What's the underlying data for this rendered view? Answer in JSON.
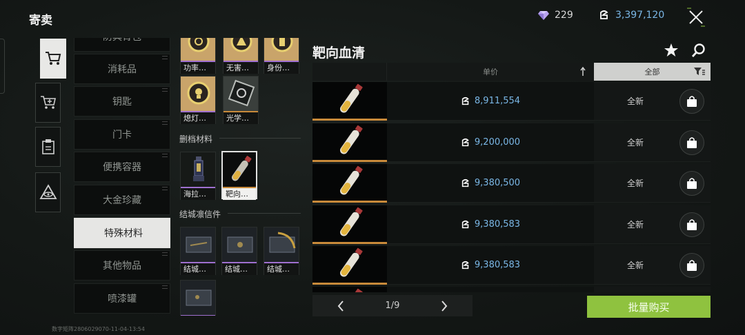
{
  "header": {
    "title": "寄卖",
    "gems": "229",
    "coins": "3,397,120"
  },
  "categories": [
    "防具背包",
    "消耗品",
    "钥匙",
    "门卡",
    "便携容器",
    "大金珍藏",
    "特殊材料",
    "其他物品",
    "喷漆罐"
  ],
  "active_category": "特殊材料",
  "grid": {
    "top_items": [
      "功率…",
      "无害…",
      "身份…",
      "熄灯…",
      "光学…"
    ],
    "section1_label": "删档材料",
    "section1_items": [
      "海拉…",
      "靶向…"
    ],
    "section2_label": "结城凛信件",
    "section2_items": [
      "结城…",
      "结城…",
      "结城…"
    ]
  },
  "panel": {
    "title": "靶向血清",
    "col_price": "单价",
    "col_filter": "全部",
    "listings": [
      {
        "price": "8,911,554",
        "condition": "全新"
      },
      {
        "price": "9,200,000",
        "condition": "全新"
      },
      {
        "price": "9,380,500",
        "condition": "全新"
      },
      {
        "price": "9,380,583",
        "condition": "全新"
      },
      {
        "price": "9,380,583",
        "condition": "全新"
      }
    ]
  },
  "pagination": {
    "page": "1/9"
  },
  "bulk_buy_label": "批量购买",
  "footer": "数字矩阵2806029070-11-04-13:54",
  "colors": {
    "accent_green": "#8fc23f",
    "price_blue": "#7ab7e6",
    "rarity_gold": "#c98a3a",
    "rarity_purple": "#a070d0"
  }
}
